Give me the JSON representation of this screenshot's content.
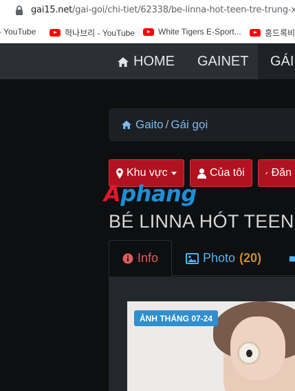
{
  "browser": {
    "url_host": "gai15.net",
    "url_path": "/gai-goi/chi-tiet/62338/be-linna-hot-teen-tre-trung-x",
    "bookmarks": [
      {
        "label": "- YouTube"
      },
      {
        "label": "혁나브리 - YouTube"
      },
      {
        "label": "White Tigers E-Sport..."
      },
      {
        "label": "흥드록비"
      }
    ]
  },
  "nav": {
    "items": [
      {
        "label": "HOME",
        "icon": "home-icon"
      },
      {
        "label": "GAINET"
      },
      {
        "label": "GÁI"
      }
    ]
  },
  "breadcrumb": {
    "home": "Gaito",
    "separator": "/",
    "current": "Gái gọi"
  },
  "actions": {
    "area": "Khu vực",
    "mine": "Của tôi",
    "post": "Đăn"
  },
  "logo": {
    "part1": "A",
    "part2": "phang"
  },
  "profile": {
    "title": "BÉ LINNA HÓT TEEN"
  },
  "tabs": {
    "info": "Info",
    "photo": "Photo",
    "photo_count": "(20)"
  },
  "photo": {
    "badge": "ẢNH THÁNG 07-24"
  },
  "colors": {
    "accent_red": "#b0131f",
    "link_blue": "#7dbbe8",
    "badge_blue": "#2f8fcf"
  }
}
